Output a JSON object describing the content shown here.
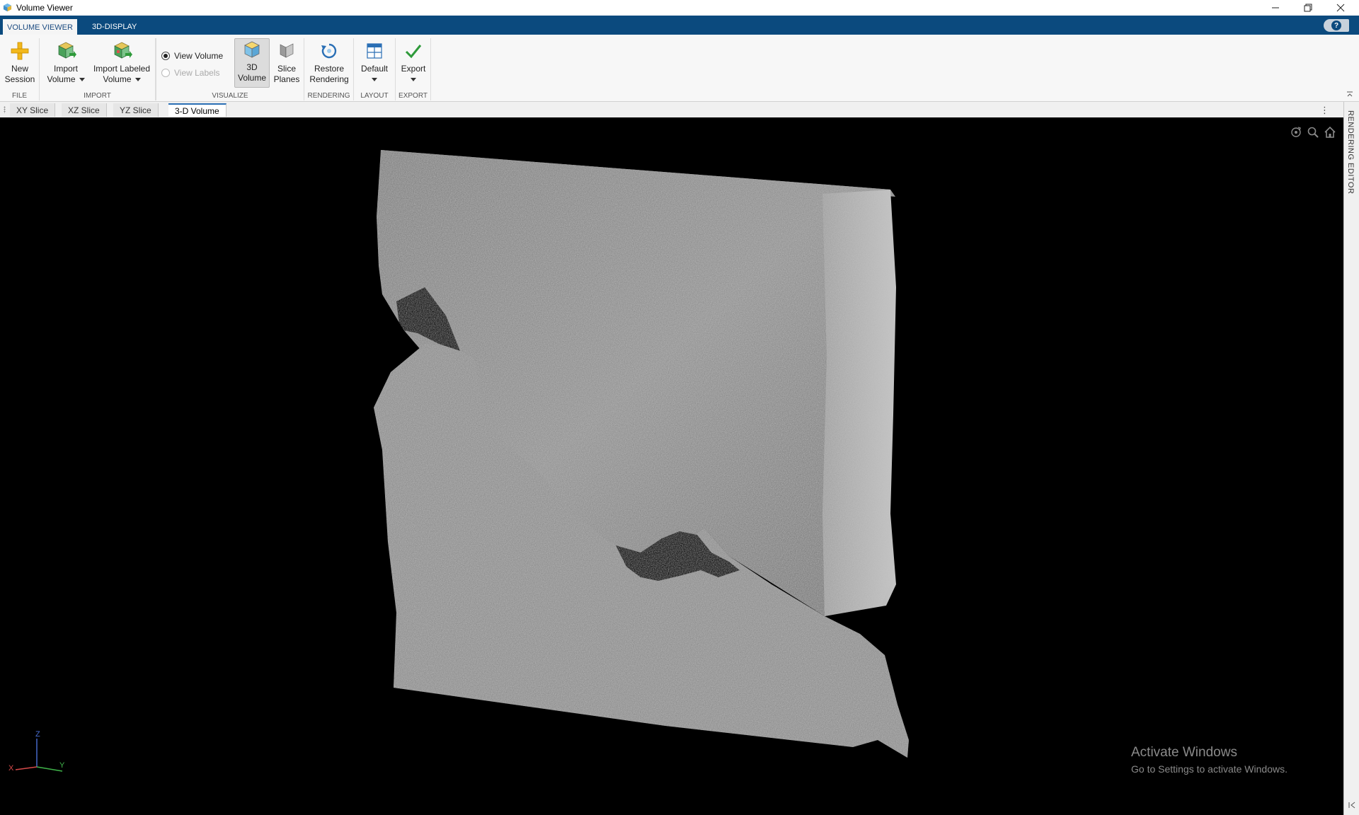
{
  "window": {
    "title": "Volume Viewer"
  },
  "top_tabs": [
    {
      "label": "VOLUME VIEWER",
      "active": true
    },
    {
      "label": "3D-DISPLAY",
      "active": false
    }
  ],
  "help": {
    "label": "?"
  },
  "toolstrip": {
    "file": {
      "group_label": "FILE",
      "new_session_line1": "New",
      "new_session_line2": "Session"
    },
    "import": {
      "group_label": "IMPORT",
      "import_volume_line1": "Import",
      "import_volume_line2": "Volume",
      "import_labeled_line1": "Import Labeled",
      "import_labeled_line2": "Volume"
    },
    "visualize": {
      "group_label": "VISUALIZE",
      "view_volume": "View Volume",
      "view_labels": "View Labels",
      "view_volume_selected": true,
      "view_labels_enabled": false,
      "volume_3d_line1": "3D",
      "volume_3d_line2": "Volume",
      "slice_planes_line1": "Slice",
      "slice_planes_line2": "Planes"
    },
    "rendering": {
      "group_label": "RENDERING",
      "restore_line1": "Restore",
      "restore_line2": "Rendering"
    },
    "layout": {
      "group_label": "LAYOUT",
      "default_label": "Default"
    },
    "export": {
      "group_label": "EXPORT",
      "export_label": "Export"
    }
  },
  "doc_tabs": [
    {
      "label": "XY Slice",
      "active": false
    },
    {
      "label": "XZ Slice",
      "active": false
    },
    {
      "label": "YZ Slice",
      "active": false
    },
    {
      "label": "3-D Volume",
      "active": true
    }
  ],
  "side_panel": {
    "label": "RENDERING EDITOR"
  },
  "axes_triad": {
    "x": "X",
    "y": "Y",
    "z": "Z"
  },
  "watermark": {
    "line1": "Activate Windows",
    "line2": "Go to Settings to activate Windows."
  },
  "colors": {
    "tabstrip": "#0b4a7e",
    "viewport": "#000000",
    "volume": "#8c8c8c",
    "accent_green": "#2e9a3a",
    "accent_blue": "#2a6fb5"
  }
}
